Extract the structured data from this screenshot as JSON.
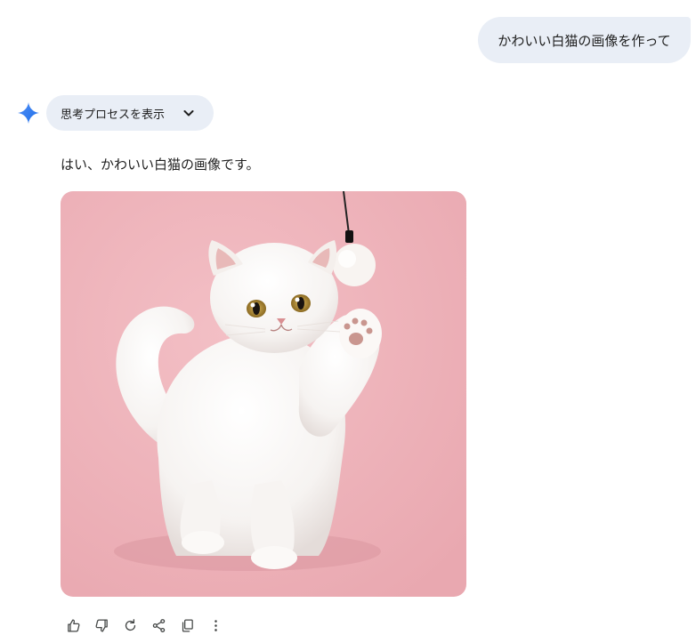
{
  "user_message": {
    "text": "かわいい白猫の画像を作って"
  },
  "assistant": {
    "icon": "gemini-spark-icon",
    "thoughts_toggle": {
      "label": "思考プロセスを表示",
      "icon": "chevron-down-icon"
    },
    "reply": "はい、かわいい白猫の画像です。",
    "image": {
      "subject": "white-cat-playing-with-toy",
      "background": "#f0b7bd"
    },
    "actions": [
      {
        "name": "thumbs-up",
        "icon": "thumbs-up-icon"
      },
      {
        "name": "thumbs-down",
        "icon": "thumbs-down-icon"
      },
      {
        "name": "regenerate",
        "icon": "refresh-icon"
      },
      {
        "name": "share",
        "icon": "share-icon"
      },
      {
        "name": "copy",
        "icon": "copy-icon"
      },
      {
        "name": "more-options",
        "icon": "more-vert-icon"
      }
    ]
  },
  "colors": {
    "bubble": "#e9eef6",
    "spark": "#4285f4",
    "text": "#1f1f1f",
    "icon": "#444746"
  }
}
